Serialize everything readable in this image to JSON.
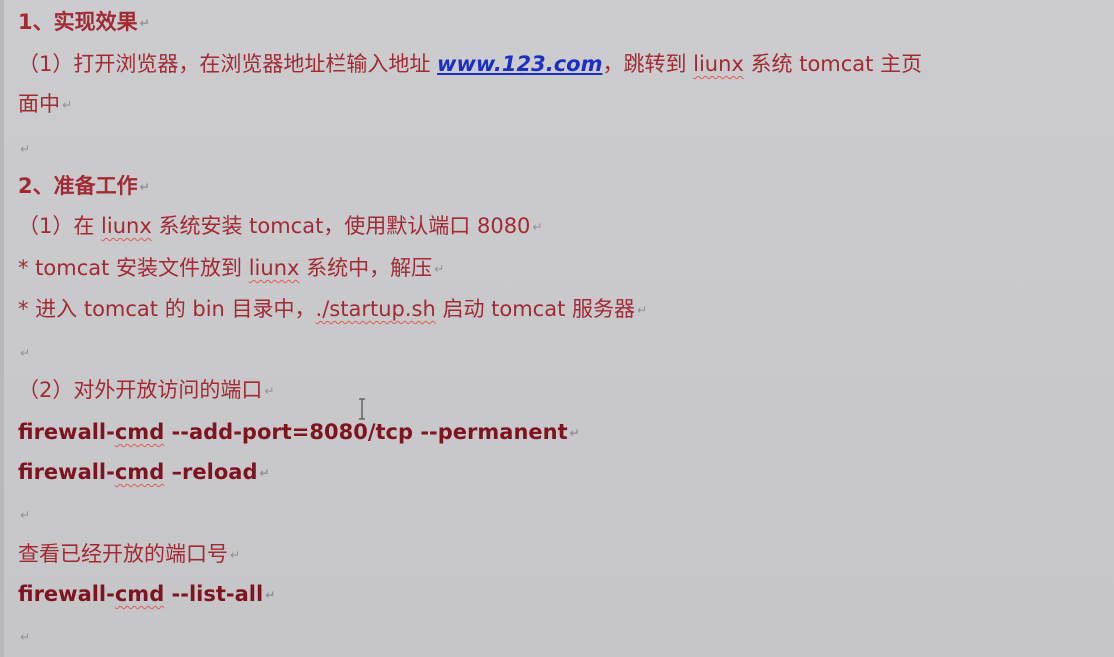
{
  "document": {
    "heading1": "1、实现效果",
    "item1_prefix": "（1）打开浏览器，在浏览器地址栏输入地址 ",
    "item1_link": "www.123.com",
    "item1_mid": "，跳转到 ",
    "item1_liunx": "liunx",
    "item1_suffix": " 系统 tomcat 主页",
    "item1_cont": "面中",
    "heading2": "2、准备工作",
    "step1_prefix": "（1）在 ",
    "step1_liunx": "liunx",
    "step1_suffix": " 系统安装 tomcat，使用默认端口 8080",
    "bullet1_prefix": "* tomcat 安装文件放到 ",
    "bullet1_liunx": "liunx",
    "bullet1_suffix": " 系统中，解压",
    "bullet2_prefix": "*  进入 tomcat 的 bin 目录中，",
    "bullet2_cmd": "./startup.sh",
    "bullet2_suffix": " 启动 tomcat 服务器",
    "step2": "（2）对外开放访问的端口",
    "cmd1_a": "firewall-",
    "cmd1_b": "cmd",
    "cmd1_c": " --add-port=8080/tcp --permanent",
    "cmd2_a": "firewall-",
    "cmd2_b": "cmd",
    "cmd2_c": " –reload",
    "view_ports": "查看已经开放的端口号",
    "cmd3_a": "firewall-",
    "cmd3_b": "cmd",
    "cmd3_c": " --list-all",
    "paragraph_mark": "↵"
  }
}
